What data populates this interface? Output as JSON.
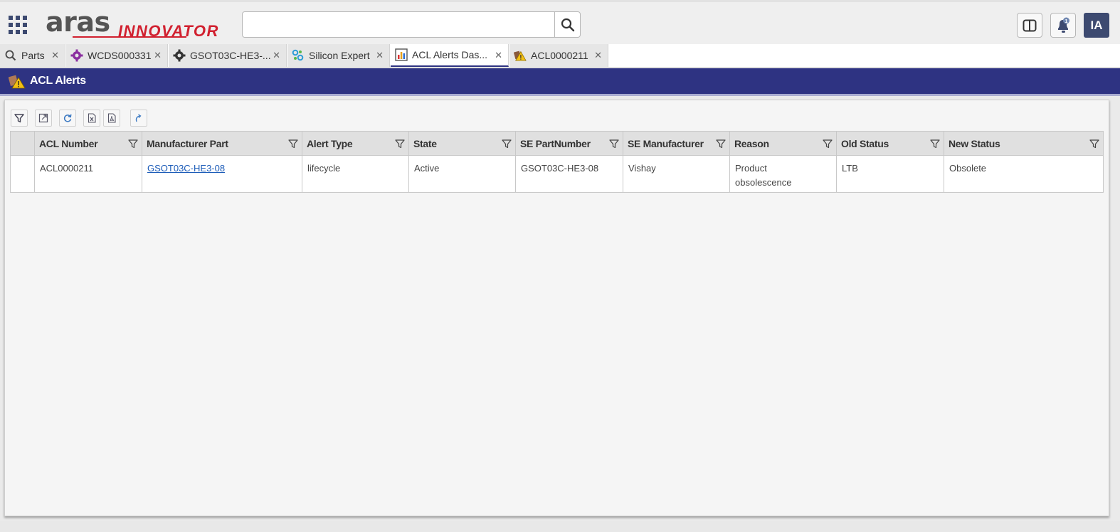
{
  "header": {
    "logo_primary": "aras",
    "logo_secondary": "INNOVATOR",
    "search_placeholder": "",
    "avatar_initials": "IA",
    "notification_count": "1"
  },
  "tabs": [
    {
      "label": "Parts",
      "icon": "search-icon"
    },
    {
      "label": "WCDS000331",
      "icon": "gear-purple-icon"
    },
    {
      "label": "GSOT03C-HE3-...",
      "icon": "gear-dark-icon"
    },
    {
      "label": "Silicon Expert",
      "icon": "silicon-expert-icon"
    },
    {
      "label": "ACL Alerts Das...",
      "icon": "dashboard-icon",
      "active": true
    },
    {
      "label": "ACL0000211",
      "icon": "alert-icon"
    }
  ],
  "title": "ACL Alerts",
  "colors": {
    "accent": "#2e3382",
    "logo_red": "#d1202f",
    "avatar": "#3d4a70"
  },
  "grid": {
    "columns": [
      "ACL Number",
      "Manufacturer Part",
      "Alert Type",
      "State",
      "SE PartNumber",
      "SE Manufacturer",
      "Reason",
      "Old Status",
      "New Status"
    ],
    "rows": [
      {
        "acl_number": "ACL0000211",
        "manufacturer_part": "GSOT03C-HE3-08",
        "alert_type": "lifecycle",
        "state": "Active",
        "se_partnumber": "GSOT03C-HE3-08",
        "se_manufacturer": "Vishay",
        "reason": "Product obsolescence",
        "old_status": "LTB",
        "new_status": "Obsolete"
      }
    ]
  }
}
